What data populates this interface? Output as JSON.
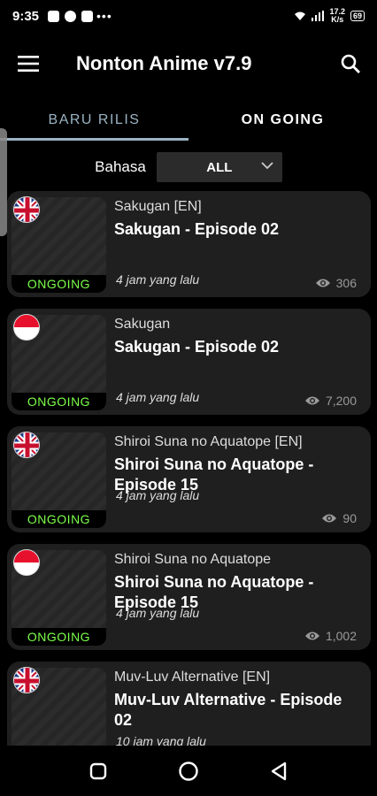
{
  "status_bar": {
    "time": "9:35",
    "dots": "•••",
    "speed_top": "17.2",
    "speed_bottom": "K/s",
    "battery": "69"
  },
  "app_bar": {
    "title": "Nonton Anime v7.9"
  },
  "tabs": [
    {
      "label": "BARU RILIS",
      "active": true
    },
    {
      "label": "ON GOING",
      "active": false
    }
  ],
  "filter": {
    "label": "Bahasa",
    "selected": "ALL"
  },
  "episodes": [
    {
      "flag": "uk",
      "series": "Sakugan [EN]",
      "title": "Sakugan - Episode 02",
      "status": "ONGOING",
      "time": "4 jam yang lalu",
      "views": "306"
    },
    {
      "flag": "id",
      "series": "Sakugan",
      "title": "Sakugan - Episode 02",
      "status": "ONGOING",
      "time": "4 jam yang lalu",
      "views": "7,200"
    },
    {
      "flag": "uk",
      "series": "Shiroi Suna no Aquatope [EN]",
      "title": "Shiroi Suna no Aquatope - Episode 15",
      "status": "ONGOING",
      "time": "4 jam yang lalu",
      "views": "90"
    },
    {
      "flag": "id",
      "series": "Shiroi Suna no Aquatope",
      "title": "Shiroi Suna no Aquatope - Episode 15",
      "status": "ONGOING",
      "time": "4 jam yang lalu",
      "views": "1,002"
    },
    {
      "flag": "uk",
      "series": "Muv-Luv Alternative [EN]",
      "title": "Muv-Luv Alternative - Episode 02",
      "status": "",
      "time": "10 jam yang lalu",
      "views": ""
    }
  ],
  "icons": {
    "menu": "hamburger-icon",
    "search": "search-icon",
    "dropdown": "chevron-down-icon",
    "views": "eye-icon",
    "back": "triangle-back-icon",
    "home": "circle-home-icon",
    "recents": "square-recents-icon"
  },
  "colors": {
    "background": "#000000",
    "card": "#1f1f1f",
    "accent_tab": "#9ab3c3",
    "ongoing": "#7cff4a"
  }
}
